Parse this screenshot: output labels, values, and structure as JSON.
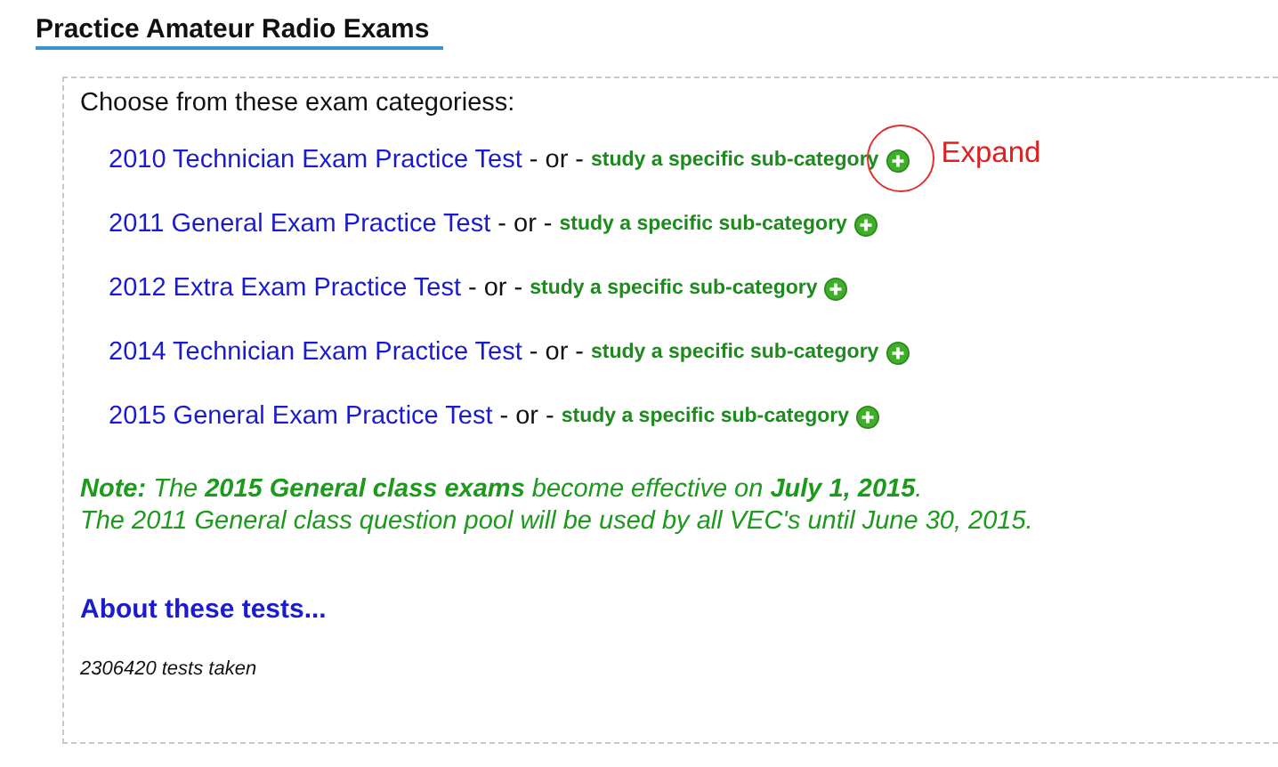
{
  "page_title": "Practice Amateur Radio Exams",
  "intro": "Choose from these exam categoriess:",
  "exams": [
    {
      "test_link": "2010 Technician Exam Practice Test",
      "separator": "- or -",
      "subcategory_link": "study a specific sub-category",
      "highlighted": true
    },
    {
      "test_link": "2011 General Exam Practice Test",
      "separator": "- or -",
      "subcategory_link": "study a specific sub-category",
      "highlighted": false
    },
    {
      "test_link": "2012 Extra Exam Practice Test",
      "separator": "- or -",
      "subcategory_link": "study a specific sub-category",
      "highlighted": false
    },
    {
      "test_link": "2014 Technician Exam Practice Test",
      "separator": "- or -",
      "subcategory_link": "study a specific sub-category",
      "highlighted": false
    },
    {
      "test_link": "2015 General Exam Practice Test",
      "separator": "- or -",
      "subcategory_link": "study a specific sub-category",
      "highlighted": false
    }
  ],
  "annotation": "Expand",
  "note_lines": [
    "**Note:** The **2015 General class exams** become effective on **July 1, 2015**.",
    "The 2011 General class question pool will be used by all VEC's until June 30, 2015."
  ],
  "about_link": "About these tests...",
  "counter": "2306420 tests taken"
}
